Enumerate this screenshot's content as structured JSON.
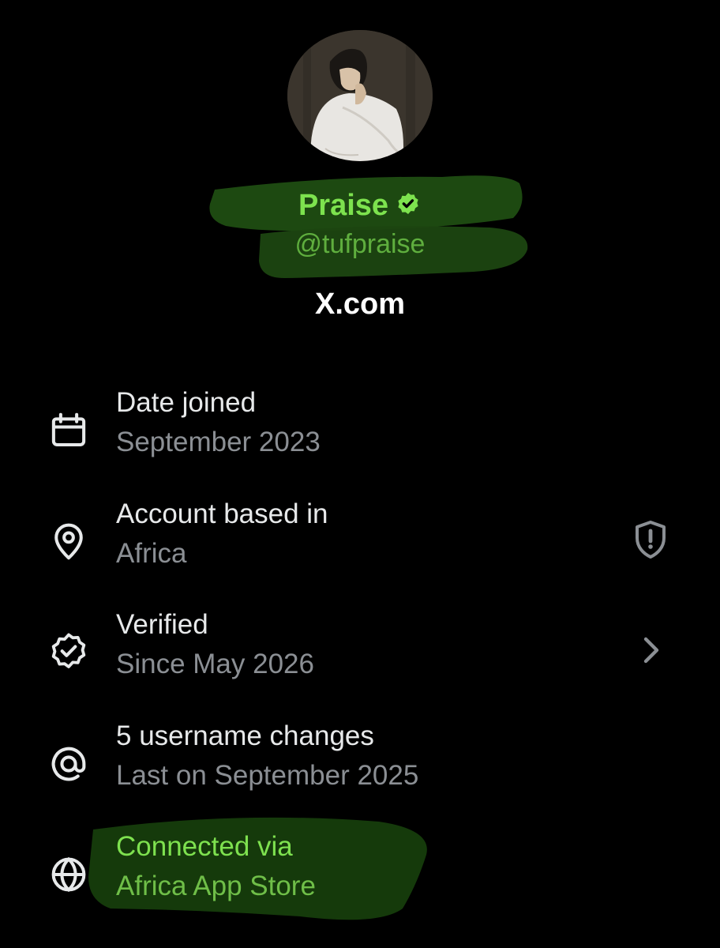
{
  "colors": {
    "accent": "#7de24e",
    "accent_dim": "#5fae3e",
    "highlight": "#1e4a12",
    "muted": "#8b8f94"
  },
  "profile": {
    "display_name": "Praise",
    "handle": "@tufpraise",
    "site": "X.com",
    "avatar_icon": "avatar",
    "verified_icon": "verified-badge-icon"
  },
  "rows": [
    {
      "id": "date-joined",
      "icon": "calendar-icon",
      "title": "Date joined",
      "subtitle": "September 2023"
    },
    {
      "id": "account-based",
      "icon": "location-pin-icon",
      "title": "Account based in",
      "subtitle": "Africa",
      "right_icon": "shield-alert-icon"
    },
    {
      "id": "verified",
      "icon": "verified-outline-icon",
      "title": "Verified",
      "subtitle": "Since May 2026",
      "right_icon": "chevron-right-icon"
    },
    {
      "id": "username-changes",
      "icon": "at-sign-icon",
      "title": "5 username changes",
      "subtitle": "Last on September 2025"
    },
    {
      "id": "connected-via",
      "icon": "globe-icon",
      "title": "Connected via",
      "subtitle": "Africa App Store"
    }
  ]
}
